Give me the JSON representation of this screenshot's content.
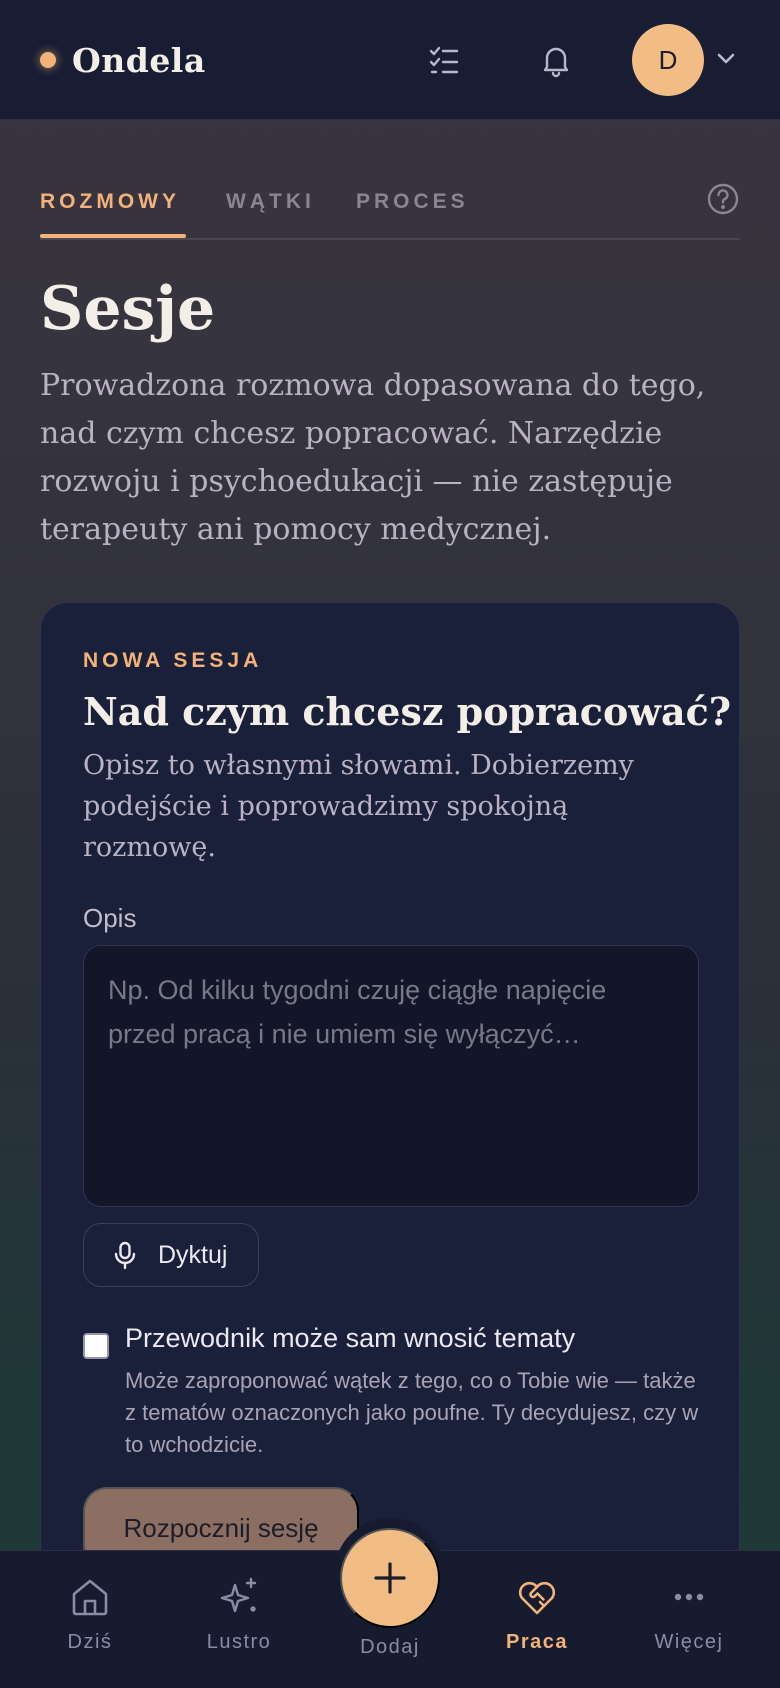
{
  "header": {
    "app_name": "Ondela",
    "avatar_initial": "D"
  },
  "tabs": [
    {
      "label": "ROZMOWY",
      "active": true
    },
    {
      "label": "WĄTKI",
      "active": false
    },
    {
      "label": "PROCES",
      "active": false
    }
  ],
  "page": {
    "title": "Sesje",
    "description": "Prowadzona rozmowa dopasowana do tego, nad czym chcesz popracować. Narzędzie rozwoju i psychoedukacji — nie zastępuje terapeuty ani pomocy medycznej."
  },
  "card": {
    "eyebrow": "NOWA SESJA",
    "title": "Nad czym chcesz popracować?",
    "subtitle": "Opisz to własnymi słowami. Dobierzemy podejście i poprowadzimy spokojną rozmowę.",
    "field_label": "Opis",
    "textarea_value": "",
    "textarea_placeholder": "Np. Od kilku tygodni czuję ciągłe napięcie przed pracą i nie umiem się wyłączyć…",
    "dictate_label": "Dyktuj",
    "checkbox_label": "Przewodnik może sam wnosić tematy",
    "checkbox_checked": false,
    "checkbox_help": "Może zaproponować wątek z tego, co o Tobie wie — także z tematów oznaczonych jako poufne. Ty decydujesz, czy w to wchodzicie.",
    "start_label": "Rozpocznij sesję"
  },
  "bottom_nav": {
    "items": [
      {
        "label": "Dziś",
        "icon": "home-icon"
      },
      {
        "label": "Lustro",
        "icon": "sparkle-icon"
      },
      {
        "label": "Dodaj",
        "icon": "plus-icon"
      },
      {
        "label": "Praca",
        "icon": "heart-handshake-icon",
        "active": true
      },
      {
        "label": "Więcej",
        "icon": "more-dots-icon"
      }
    ]
  },
  "colors": {
    "accent": "#f2b27a",
    "header_bg": "#181d33",
    "card_bg": "#1a1f3a",
    "nav_inactive": "#8a8ba8"
  }
}
